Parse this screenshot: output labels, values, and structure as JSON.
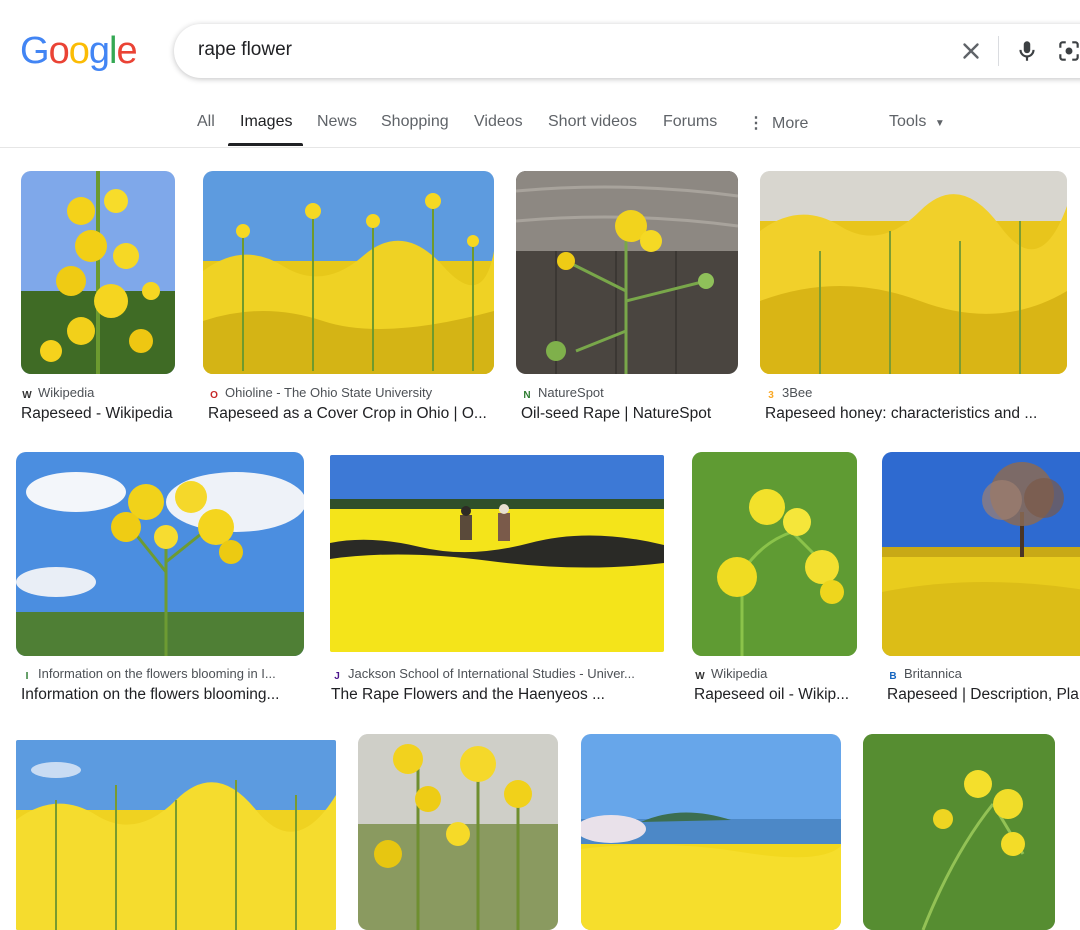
{
  "brand": {
    "logo_letters": [
      "G",
      "o",
      "o",
      "g",
      "l",
      "e"
    ],
    "logo_colors": [
      "#4285F4",
      "#EA4335",
      "#FBBC05",
      "#4285F4",
      "#34A853",
      "#EA4335"
    ]
  },
  "search": {
    "query": "rape flower",
    "icons": [
      "close-icon",
      "microphone-icon",
      "lens-icon"
    ]
  },
  "tabs": [
    {
      "label": "All"
    },
    {
      "label": "Images",
      "active": true
    },
    {
      "label": "News"
    },
    {
      "label": "Shopping"
    },
    {
      "label": "Videos"
    },
    {
      "label": "Short videos"
    },
    {
      "label": "Forums"
    },
    {
      "label": "More"
    },
    {
      "label": "Tools"
    }
  ],
  "colors": {
    "rapeseed_yellow": "#f2d21b",
    "sky_blue": "#5b9be0",
    "foliage_green": "#5f8f2e",
    "text_primary": "#202124",
    "text_secondary": "#4d5156"
  },
  "results": [
    {
      "source": "Wikipedia",
      "favicon": "W",
      "title": "Rapeseed - Wikipedia"
    },
    {
      "source": "Ohioline - The Ohio State University",
      "favicon": "O",
      "title": "Rapeseed as a Cover Crop in Ohio | O..."
    },
    {
      "source": "NatureSpot",
      "favicon": "N",
      "title": "Oil-seed Rape | NatureSpot"
    },
    {
      "source": "3Bee",
      "favicon": "3",
      "title": "Rapeseed honey: characteristics and ..."
    },
    {
      "source": "Information on the flowers blooming in I...",
      "favicon": "I",
      "title": "Information on the flowers blooming..."
    },
    {
      "source": "Jackson School of International Studies - Univer...",
      "favicon": "J",
      "title": "The Rape Flowers and the Haenyeos ..."
    },
    {
      "source": "Wikipedia",
      "favicon": "W",
      "title": "Rapeseed oil - Wikip..."
    },
    {
      "source": "Britannica",
      "favicon": "B",
      "title": "Rapeseed | Description, Pla"
    },
    {
      "source": "",
      "favicon": "",
      "title": ""
    },
    {
      "source": "",
      "favicon": "",
      "title": ""
    },
    {
      "source": "",
      "favicon": "",
      "title": ""
    },
    {
      "source": "",
      "favicon": "",
      "title": ""
    }
  ]
}
